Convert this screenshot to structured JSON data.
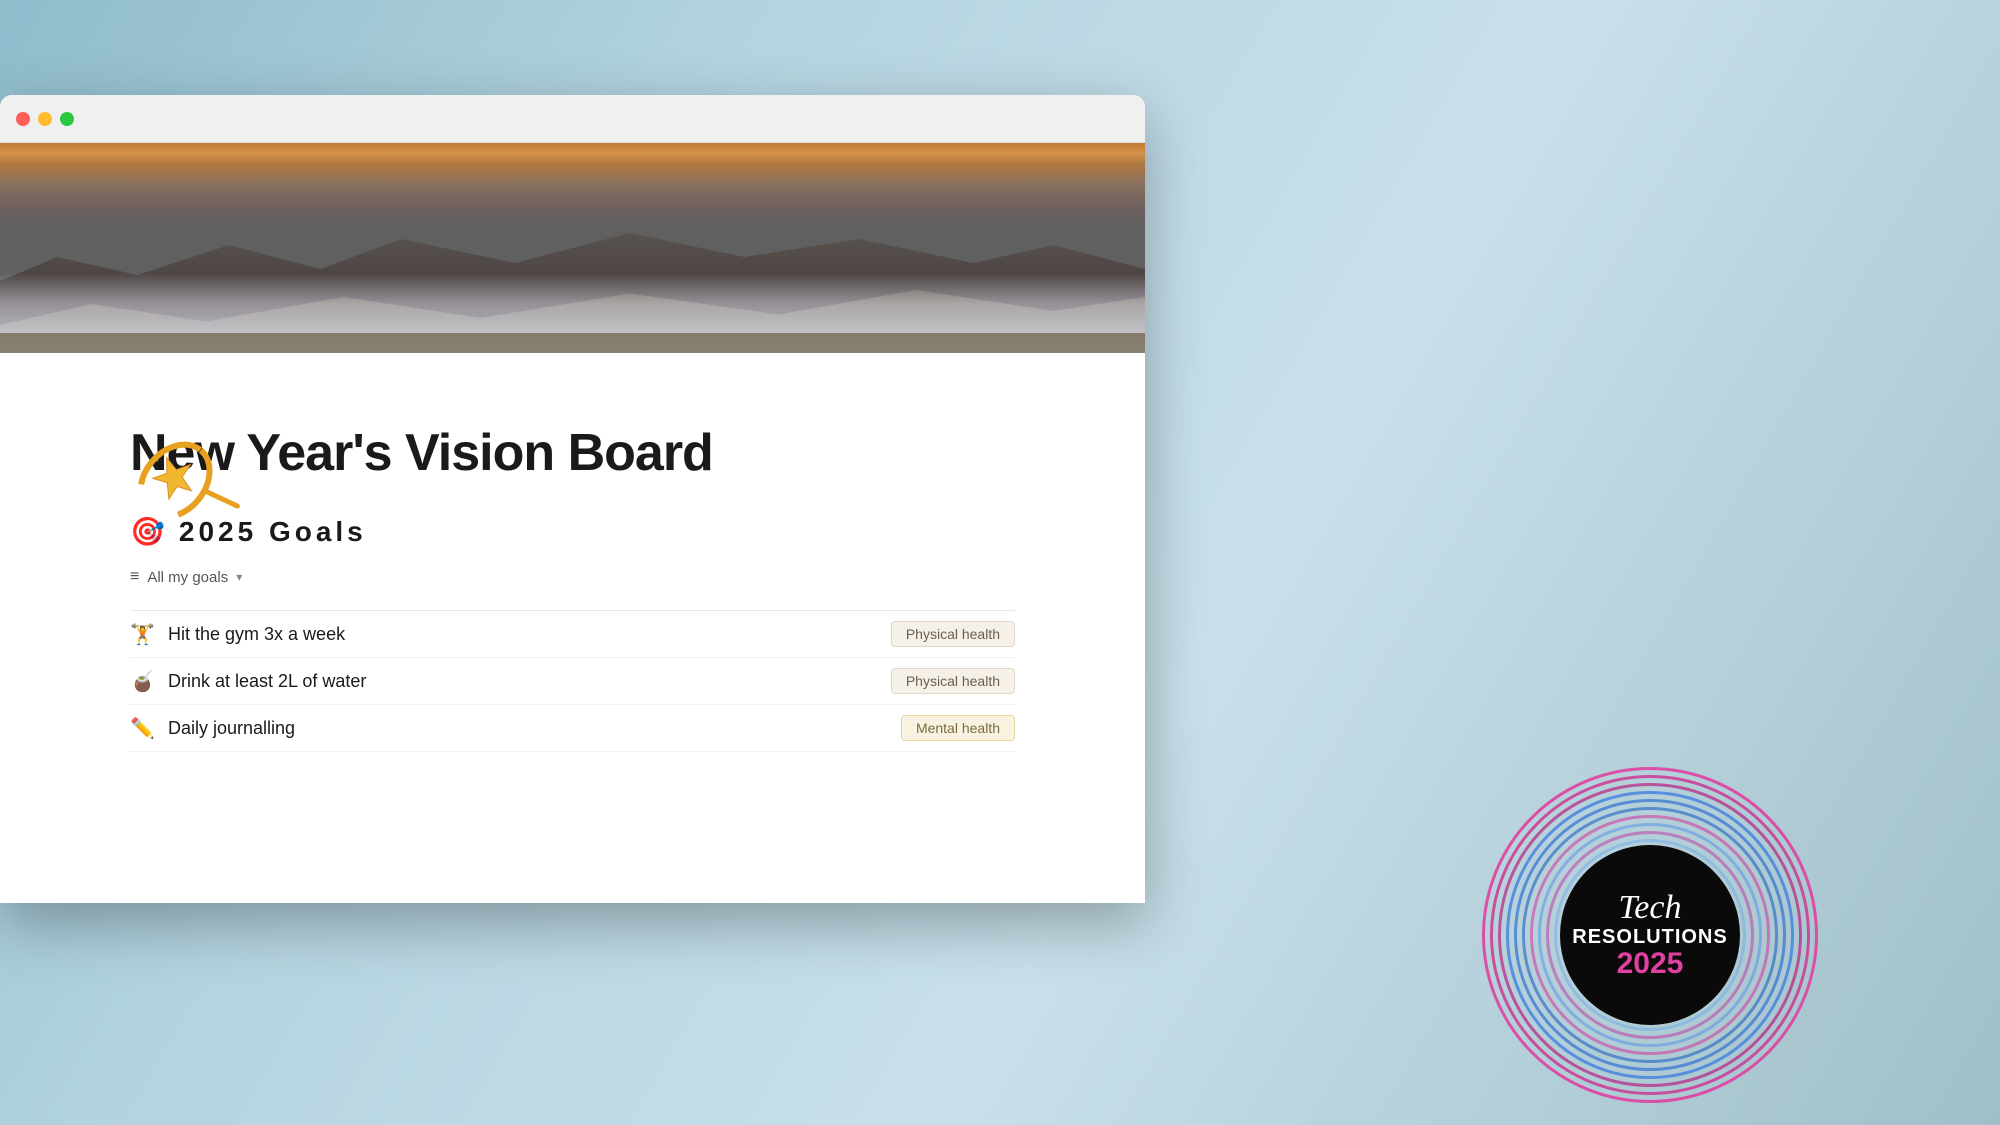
{
  "browser": {
    "traffic_lights": [
      "red",
      "yellow",
      "green"
    ]
  },
  "hero": {
    "alt": "Coastal rocky landscape with mist"
  },
  "shooting_star": "🌟",
  "page": {
    "title": "New Year's Vision Board",
    "goals_heading": "2025 Goals",
    "goals_icon": "🎯",
    "filter": {
      "icon": "≡",
      "label": "All my goals",
      "chevron": "▾"
    },
    "goals": [
      {
        "icon": "🏋",
        "text": "Hit the gym 3x a week",
        "tag": "Physical health",
        "tag_type": "physical"
      },
      {
        "icon": "🧉",
        "text": "Drink at least 2L of water",
        "tag": "Physical health",
        "tag_type": "physical"
      },
      {
        "icon": "✏",
        "text": "Daily journalling",
        "tag": "Mental health",
        "tag_type": "mental"
      }
    ]
  },
  "badge": {
    "tech": "Tech",
    "resolutions": "RESOLUTIONS",
    "year": "2025"
  },
  "detected_tags": {
    "physical_health_1": "Physical health",
    "physical_health_2": "Physical health",
    "mental_health": "Mental health"
  }
}
